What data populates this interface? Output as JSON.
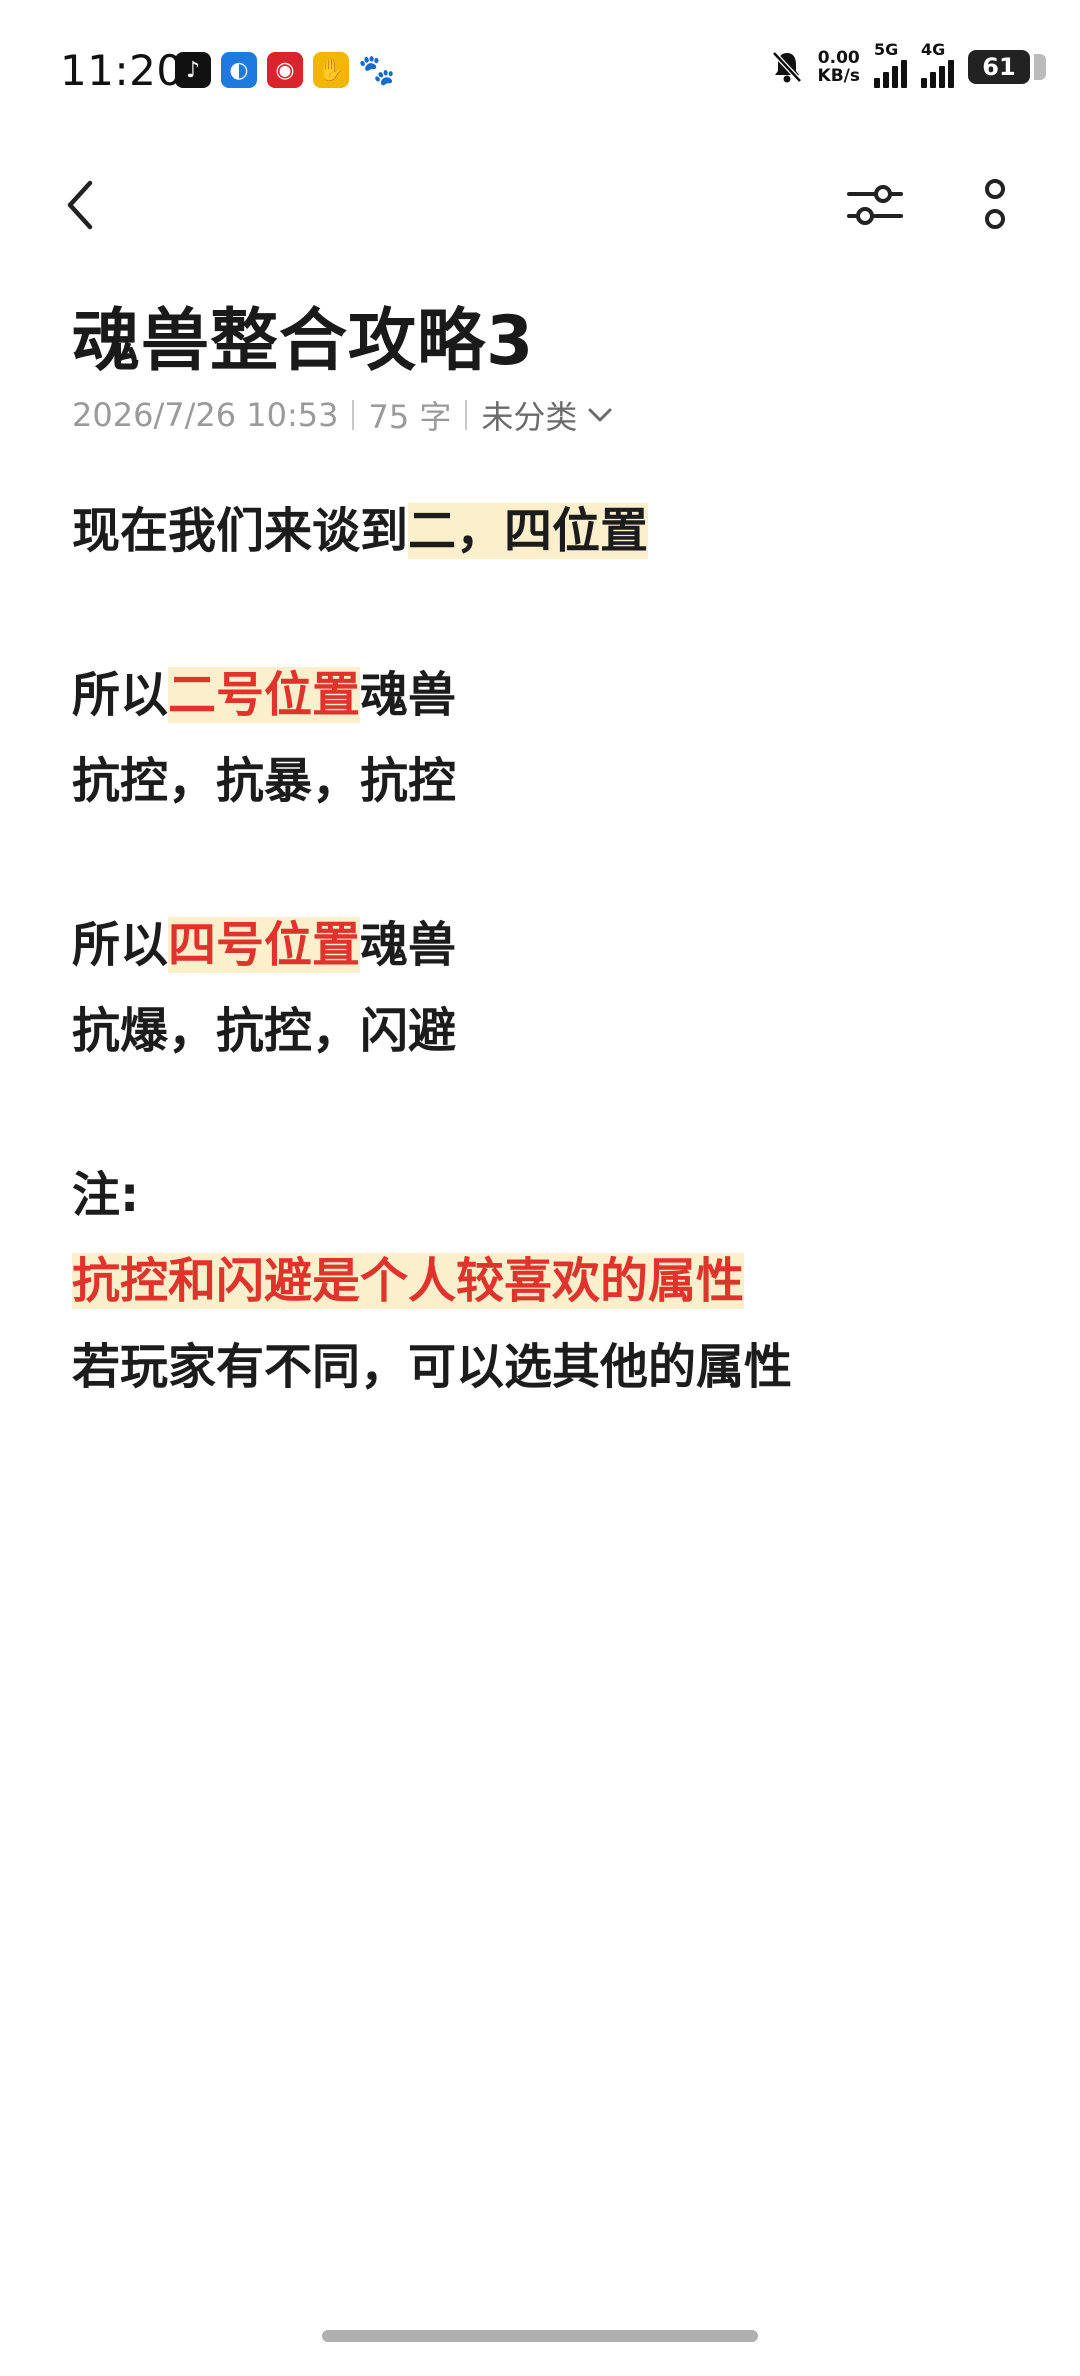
{
  "status_bar": {
    "time": "11:20",
    "speed_value": "0.00",
    "speed_unit": "KB/s",
    "net1": "5G",
    "net2": "4G",
    "battery": "61",
    "app_icons": [
      "tiktok-icon",
      "browser-icon",
      "red-app-icon",
      "yellow-app-icon",
      "baidu-paw-icon"
    ]
  },
  "note": {
    "title": "魂兽整合攻略3",
    "date": "2026/7/26 10:53",
    "word_count": "75 字",
    "category": "未分类"
  },
  "body": {
    "l1_plain": "现在我们来谈到",
    "l1_hl": "二，四位置",
    "l2_a": "所以",
    "l2_red": "二号位置",
    "l2_b": "魂兽",
    "l3": "抗控，抗暴，抗控",
    "l4_a": "所以",
    "l4_red": "四号位置",
    "l4_b": "魂兽",
    "l5": "抗爆，抗控，闪避",
    "l6": "注:",
    "l7_red": "抗控和闪避是个人较喜欢的属性",
    "l8": "若玩家有不同，可以选其他的属性"
  },
  "colors": {
    "highlight": "#fbefcc",
    "accent_red": "#e0332c"
  }
}
